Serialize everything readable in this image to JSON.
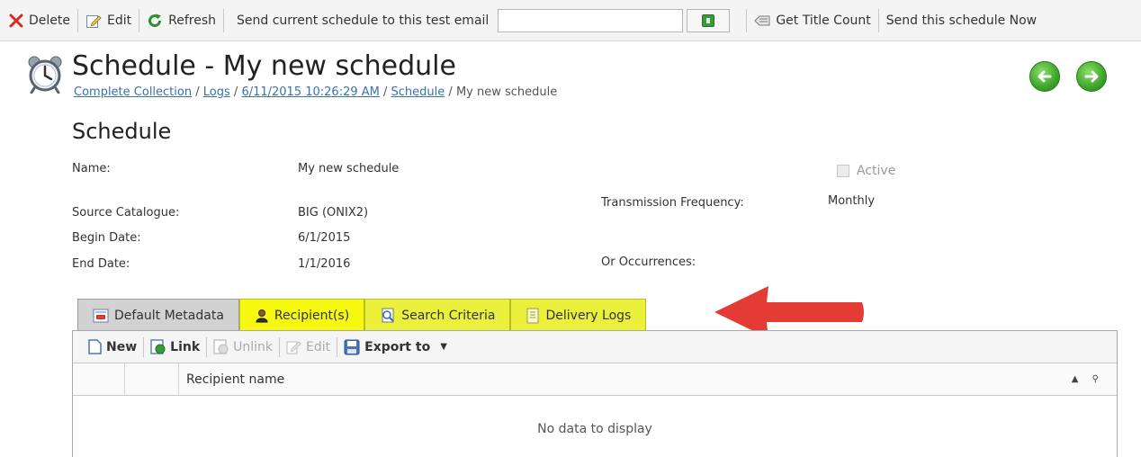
{
  "toolbar": {
    "delete_label": "Delete",
    "edit_label": "Edit",
    "refresh_label": "Refresh",
    "send_test_label": "Send current schedule to this test email",
    "test_email_value": "",
    "get_title_count_label": "Get Title Count",
    "send_now_label": "Send this schedule Now"
  },
  "header": {
    "title": "Schedule - My new schedule",
    "breadcrumb": {
      "items": [
        "Complete Collection",
        "Logs",
        "6/11/2015 10:26:29 AM",
        "Schedule"
      ],
      "current": "My new schedule",
      "separator": "/"
    }
  },
  "section": {
    "title": "Schedule"
  },
  "fields": {
    "name_label": "Name:",
    "name_value": "My new schedule",
    "active_label": "Active",
    "active_checked": false,
    "source_catalogue_label": "Source Catalogue:",
    "source_catalogue_value": "BIG (ONIX2)",
    "transmission_frequency_label": "Transmission Frequency:",
    "transmission_frequency_value": "Monthly",
    "begin_date_label": "Begin Date:",
    "begin_date_value": "6/1/2015",
    "end_date_label": "End Date:",
    "end_date_value": "1/1/2016",
    "or_occurrences_label": "Or Occurrences:"
  },
  "tabs": [
    {
      "label": "Default Metadata",
      "icon": "metadata-icon"
    },
    {
      "label": "Recipient(s)",
      "icon": "person-icon"
    },
    {
      "label": "Search Criteria",
      "icon": "search-criteria-icon"
    },
    {
      "label": "Delivery Logs",
      "icon": "log-icon"
    }
  ],
  "grid": {
    "toolbar": {
      "new_label": "New",
      "link_label": "Link",
      "unlink_label": "Unlink",
      "edit_label": "Edit",
      "export_label": "Export to"
    },
    "column_header": "Recipient name",
    "empty_text": "No data to display"
  },
  "colors": {
    "tab_highlight": "#eaf03b",
    "annotation_arrow": "#e53b35",
    "nav_button": "#3da52a",
    "link": "#3a6fb0"
  }
}
